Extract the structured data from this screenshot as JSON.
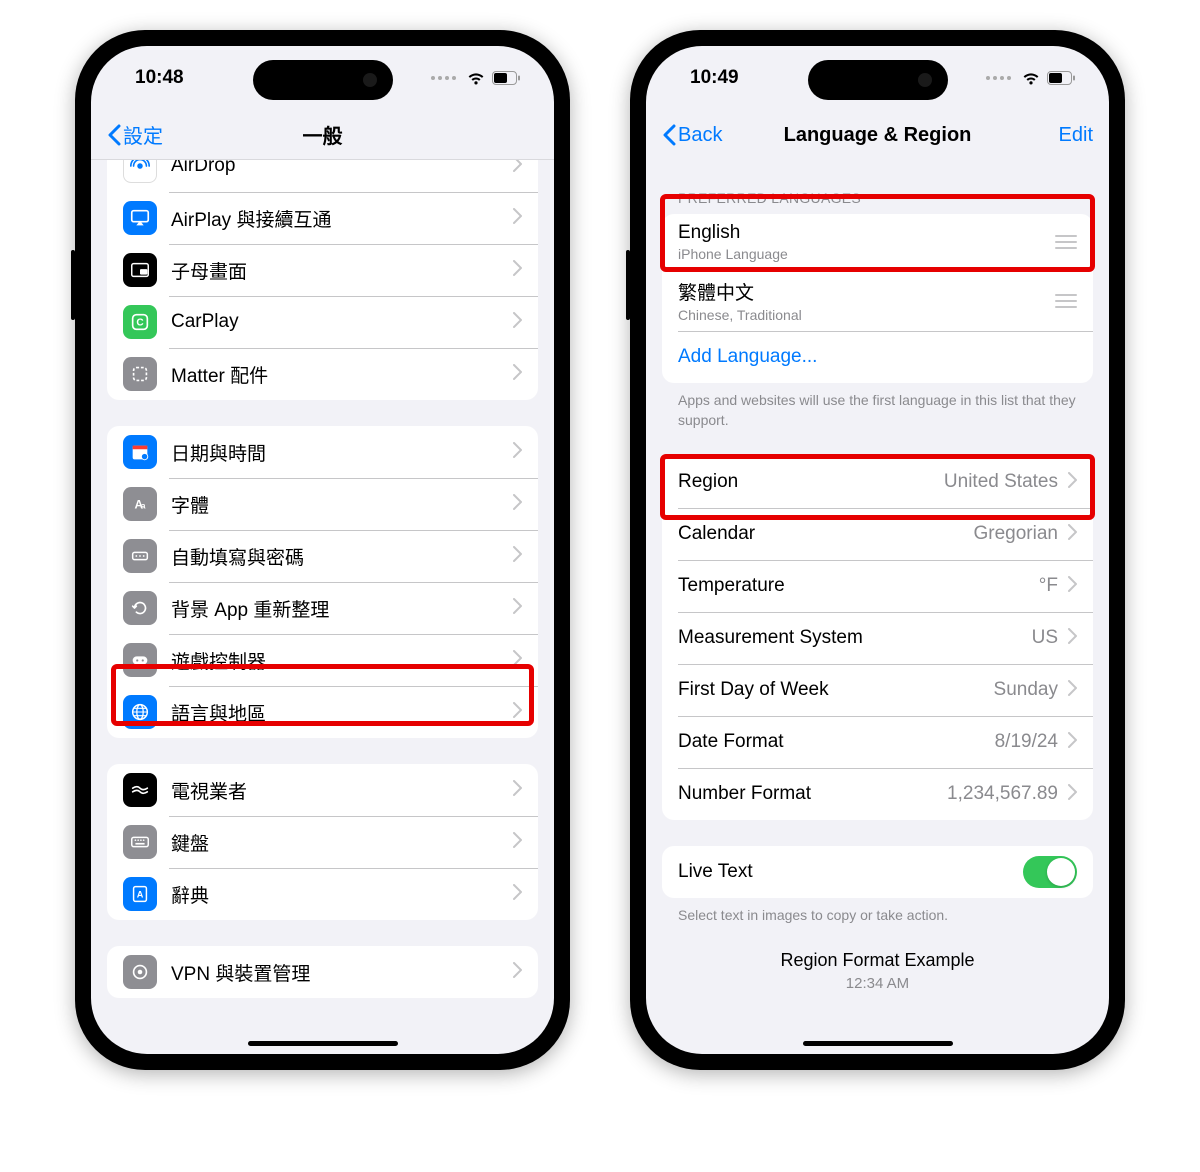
{
  "left": {
    "time": "10:48",
    "nav_back": "設定",
    "nav_title": "一般",
    "group1": [
      {
        "id": "airdrop",
        "label": "AirDrop",
        "iconBg": "#fff",
        "iconStroke": "#007aff"
      },
      {
        "id": "airplay",
        "label": "AirPlay 與接續互通",
        "iconBg": "#007aff"
      },
      {
        "id": "pip",
        "label": "子母畫面",
        "iconBg": "#000"
      },
      {
        "id": "carplay",
        "label": "CarPlay",
        "iconBg": "#34c759"
      },
      {
        "id": "matter",
        "label": "Matter 配件",
        "iconBg": "#8e8e93"
      }
    ],
    "group2": [
      {
        "id": "datetime",
        "label": "日期與時間",
        "iconBg": "#007aff"
      },
      {
        "id": "fonts",
        "label": "字體",
        "iconBg": "#8e8e93"
      },
      {
        "id": "autofill",
        "label": "自動填寫與密碼",
        "iconBg": "#8e8e93"
      },
      {
        "id": "bgrefresh",
        "label": "背景 App 重新整理",
        "iconBg": "#8e8e93"
      },
      {
        "id": "gamectrl",
        "label": "遊戲控制器",
        "iconBg": "#8e8e93"
      },
      {
        "id": "langregion",
        "label": "語言與地區",
        "iconBg": "#007aff"
      }
    ],
    "group3": [
      {
        "id": "tvprovider",
        "label": "電視業者",
        "iconBg": "#000"
      },
      {
        "id": "keyboard",
        "label": "鍵盤",
        "iconBg": "#8e8e93"
      },
      {
        "id": "dictionary",
        "label": "辭典",
        "iconBg": "#007aff"
      }
    ],
    "group4": [
      {
        "id": "vpn",
        "label": "VPN 與裝置管理",
        "iconBg": "#8e8e93"
      }
    ]
  },
  "right": {
    "time": "10:49",
    "nav_back": "Back",
    "nav_title": "Language & Region",
    "nav_edit": "Edit",
    "pref_header": "PREFERRED LANGUAGES",
    "languages": [
      {
        "name": "English",
        "sub": "iPhone Language"
      },
      {
        "name": "繁體中文",
        "sub": "Chinese, Traditional"
      }
    ],
    "add_language": "Add Language...",
    "pref_footer": "Apps and websites will use the first language in this list that they support.",
    "settings": [
      {
        "label": "Region",
        "value": "United States"
      },
      {
        "label": "Calendar",
        "value": "Gregorian"
      },
      {
        "label": "Temperature",
        "value": "°F"
      },
      {
        "label": "Measurement System",
        "value": "US"
      },
      {
        "label": "First Day of Week",
        "value": "Sunday"
      },
      {
        "label": "Date Format",
        "value": "8/19/24"
      },
      {
        "label": "Number Format",
        "value": "1,234,567.89"
      }
    ],
    "live_text": "Live Text",
    "live_text_footer": "Select text in images to copy or take action.",
    "example_header": "Region Format Example",
    "example_sub": "12:34 AM"
  }
}
